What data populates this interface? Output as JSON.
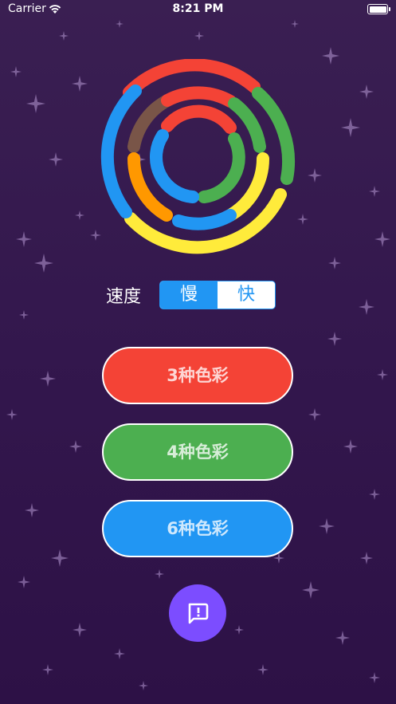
{
  "status_bar": {
    "carrier": "Carrier",
    "time": "8:21 PM"
  },
  "speed": {
    "label": "速度",
    "options": [
      "慢",
      "快"
    ],
    "selected": "慢"
  },
  "buttons": {
    "three_colors": "3种色彩",
    "four_colors": "4种色彩",
    "six_colors": "6种色彩"
  },
  "colors": {
    "red": "#f44336",
    "green": "#4caf50",
    "blue": "#2196f3",
    "yellow": "#ffeb3b",
    "orange": "#ff9800",
    "brown": "#795548",
    "purple_fab": "#7c4dff"
  },
  "icons": {
    "fab": "feedback-icon"
  }
}
